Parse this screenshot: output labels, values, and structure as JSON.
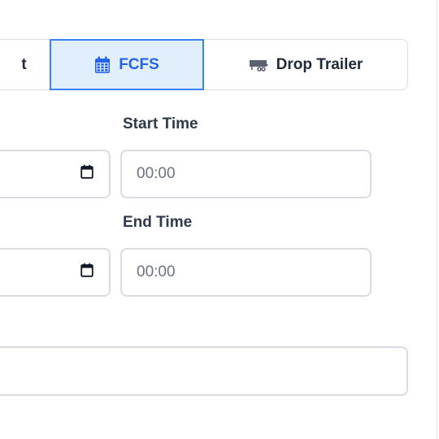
{
  "tabs": {
    "left_partial_label": "t",
    "fcfs_label": "FCFS",
    "drop_trailer_label": "Drop Trailer"
  },
  "start_time": {
    "label": "Start Time",
    "placeholder": "00:00"
  },
  "end_time": {
    "label": "End Time",
    "placeholder": "00:00"
  },
  "colors": {
    "accent": "#2563eb",
    "active_bg": "#e1effd",
    "border": "#d9dce1",
    "label_text": "#2f3a4a"
  },
  "icons": {
    "fcfs": "calendar-icon",
    "drop_trailer": "trailer-icon",
    "date_picker": "calendar-icon"
  }
}
